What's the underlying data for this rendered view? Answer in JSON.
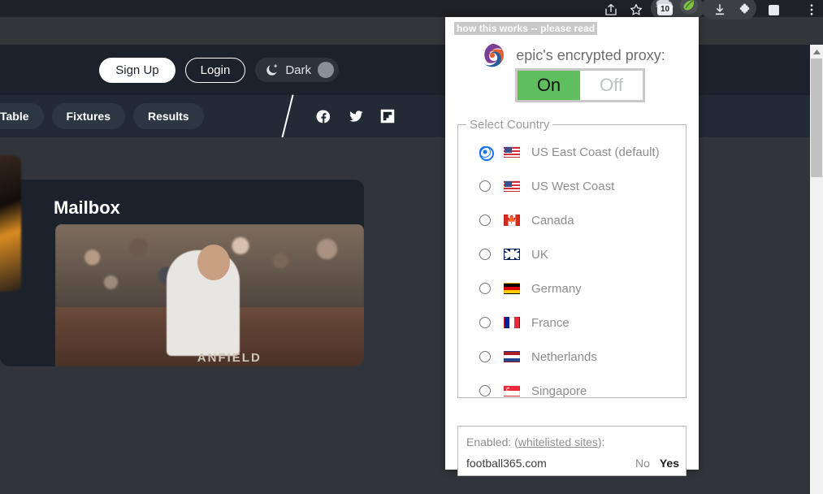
{
  "browser": {
    "toolbar_icons": [
      {
        "name": "share-icon",
        "glyph": "share"
      },
      {
        "name": "bookmark-star-icon",
        "glyph": "star"
      },
      {
        "name": "cloud-extension-icon",
        "glyph": "cloud",
        "badge": "10"
      },
      {
        "name": "epic-proxy-extension-icon",
        "glyph": "epic-leaf"
      },
      {
        "name": "downloads-icon",
        "glyph": "download-arrow"
      },
      {
        "name": "extensions-puzzle-icon",
        "glyph": "puzzle"
      },
      {
        "name": "side-panel-icon",
        "glyph": "panel"
      },
      {
        "name": "chrome-menu-icon",
        "glyph": "kebab"
      }
    ],
    "extension_badge_count": "10",
    "scrollbar": {
      "visible": true
    }
  },
  "popup": {
    "how_it_works_link": "how this works -- please read",
    "brand_logo_name": "epic-browser-logo",
    "title": "epic's encrypted proxy:",
    "toggle": {
      "on_label": "On",
      "off_label": "Off",
      "selected": "On",
      "on_color": "#5fbf5f"
    },
    "country_group": {
      "legend": "Select Country",
      "selected_index": 0,
      "items": [
        {
          "label": "US East Coast (default)",
          "flag": "us",
          "selected": true
        },
        {
          "label": "US West Coast",
          "flag": "us",
          "selected": false
        },
        {
          "label": "Canada",
          "flag": "ca",
          "selected": false
        },
        {
          "label": "UK",
          "flag": "uk",
          "selected": false
        },
        {
          "label": "Germany",
          "flag": "de",
          "selected": false
        },
        {
          "label": "France",
          "flag": "fr",
          "selected": false
        },
        {
          "label": "Netherlands",
          "flag": "nl",
          "selected": false
        },
        {
          "label": "Singapore",
          "flag": "sg",
          "selected": false
        }
      ]
    },
    "enabled_section": {
      "prefix": "Enabled: (",
      "link": "whitelisted sites",
      "suffix": "):",
      "site": "football365.com",
      "answer_no": "No",
      "answer_yes": "Yes",
      "answer_selected": "Yes"
    }
  },
  "site": {
    "topbar": {
      "sign_up": "Sign Up",
      "login": "Login",
      "dark_label": "Dark",
      "dark_icon": "moon-icon"
    },
    "nav": {
      "items": [
        {
          "label": "Table",
          "clipped": true
        },
        {
          "label": "Fixtures",
          "clipped": false
        },
        {
          "label": "Results",
          "clipped": false
        }
      ],
      "social": [
        {
          "name": "facebook-icon"
        },
        {
          "name": "twitter-icon"
        },
        {
          "name": "flipboard-icon"
        }
      ]
    },
    "mailbox_card": {
      "title": "Mailbox",
      "photo_caption": "ANFIELD"
    }
  },
  "colors": {
    "page_bg": "#32343c",
    "site_topbar_bg": "#1c222b",
    "site_nav_bg": "#222a35",
    "chrome_toolbar": "#202124",
    "chrome_band": "#35363a",
    "accent_green": "#5fbf5f",
    "accent_blue": "#1a73e8"
  }
}
